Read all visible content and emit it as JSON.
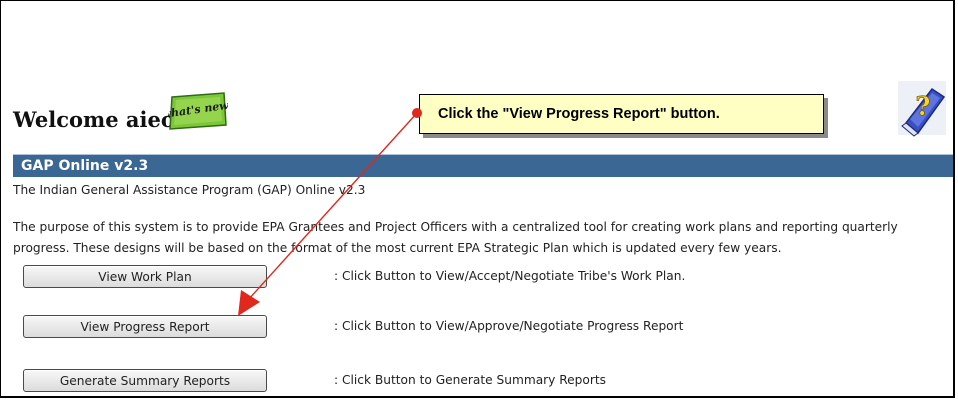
{
  "header": {
    "welcome": "Welcome aieo1",
    "whats_new_badge": "what's new!"
  },
  "callout": {
    "text": "Click the \"View Progress Report\" button."
  },
  "panel": {
    "title": "GAP Online v2.3",
    "intro": "The Indian General Assistance Program (GAP) Online v2.3",
    "purpose": "The purpose of this system is to provide EPA Grantees and Project Officers with a centralized tool for creating work plans and reporting quarterly progress. These designs will be based on the format of the most current EPA Strategic Plan which is updated every few years."
  },
  "actions": [
    {
      "label": "View Work Plan",
      "description": ": Click Button to View/Accept/Negotiate Tribe's Work Plan."
    },
    {
      "label": "View Progress Report",
      "description": ": Click Button to View/Approve/Negotiate Progress Report"
    },
    {
      "label": "Generate Summary Reports",
      "description": ": Click Button to Generate Summary Reports"
    }
  ],
  "colors": {
    "title_bar": "#3a6794",
    "callout_bg": "#ffffc4",
    "arrow": "#e0281c",
    "badge_green": "#7cc63a"
  },
  "icons": [
    "whats-new-badge",
    "help-book-icon",
    "pointer-arrow"
  ]
}
